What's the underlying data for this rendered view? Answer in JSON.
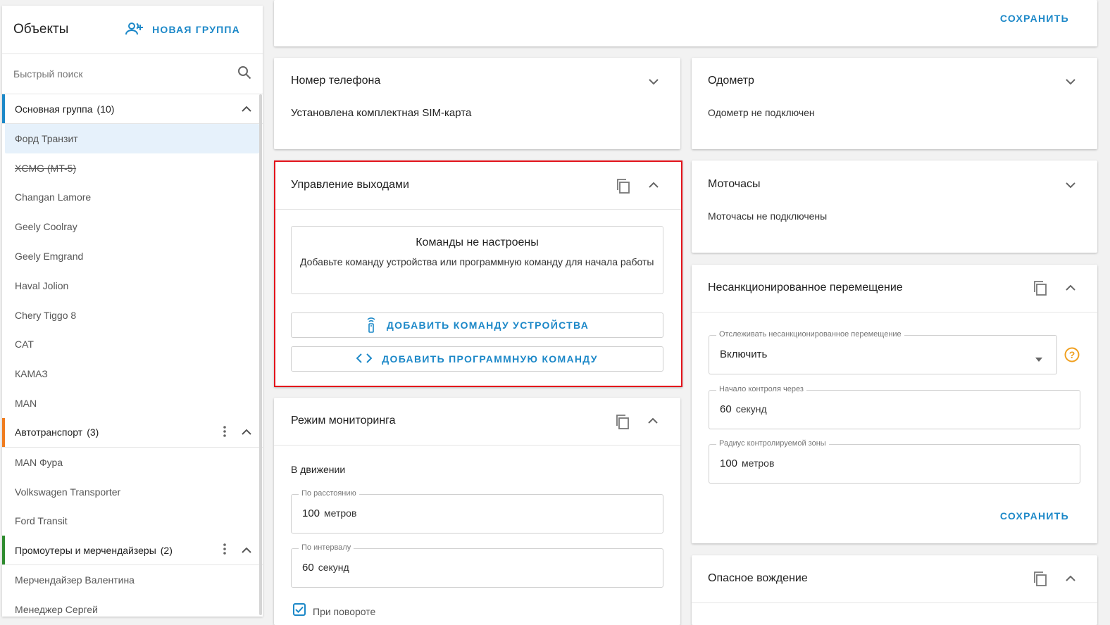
{
  "sidebar": {
    "title": "Объекты",
    "new_group_label": "НОВАЯ ГРУППА",
    "search_placeholder": "Быстрый поиск",
    "groups": [
      {
        "name": "Основная группа",
        "count": "(10)",
        "color": "#1c88c8",
        "items": [
          "Форд Транзит",
          "XCMG (MT-5)",
          "Changan Lamore",
          "Geely Coolray",
          "Geely Emgrand",
          "Haval Jolion",
          "Chery Tiggo 8",
          "CAT",
          "КАМАЗ",
          "MAN"
        ]
      },
      {
        "name": "Автотранспорт",
        "count": "(3)",
        "color": "#f07c1e",
        "items": [
          "MAN Фура",
          "Volkswagen Transporter",
          "Ford Transit"
        ]
      },
      {
        "name": "Промоутеры и мерчендайзеры",
        "count": "(2)",
        "color": "#2e8b2e",
        "items": [
          "Мерчендайзер Валентина",
          "Менеджер Сергей"
        ]
      }
    ]
  },
  "topbar": {
    "save_label": "СОХРАНИТЬ"
  },
  "phone": {
    "title": "Номер телефона",
    "text": "Установлена комплектная SIM-карта"
  },
  "odometer": {
    "title": "Одометр",
    "text": "Одометр не подключен"
  },
  "outputs": {
    "title": "Управление выходами",
    "empty_title": "Команды не настроены",
    "empty_text": "Добавьте команду устройства или программную команду для начала работы",
    "add_device_cmd": "ДОБАВИТЬ КОМАНДУ УСТРОЙСТВА",
    "add_program_cmd": "ДОБАВИТЬ ПРОГРАММНУЮ КОМАНДУ",
    "highlight_color": "#e3131b"
  },
  "motohours": {
    "title": "Моточасы",
    "text": "Моточасы не подключены"
  },
  "unauthorized": {
    "title": "Несанкционированное перемещение",
    "track_label": "Отслеживать несанкционированное перемещение",
    "track_value": "Включить",
    "start_label": "Начало контроля через",
    "start_value": "60",
    "start_unit": "секунд",
    "radius_label": "Радиус контролируемой зоны",
    "radius_value": "100",
    "radius_unit": "метров",
    "save_label": "СОХРАНИТЬ"
  },
  "monitoring": {
    "title": "Режим мониторинга",
    "section": "В движении",
    "distance_label": "По расстоянию",
    "distance_value": "100",
    "distance_unit": "метров",
    "interval_label": "По интервалу",
    "interval_value": "60",
    "interval_unit": "секунд",
    "turn_label": "При повороте"
  },
  "dangerous": {
    "title": "Опасное вождение"
  }
}
